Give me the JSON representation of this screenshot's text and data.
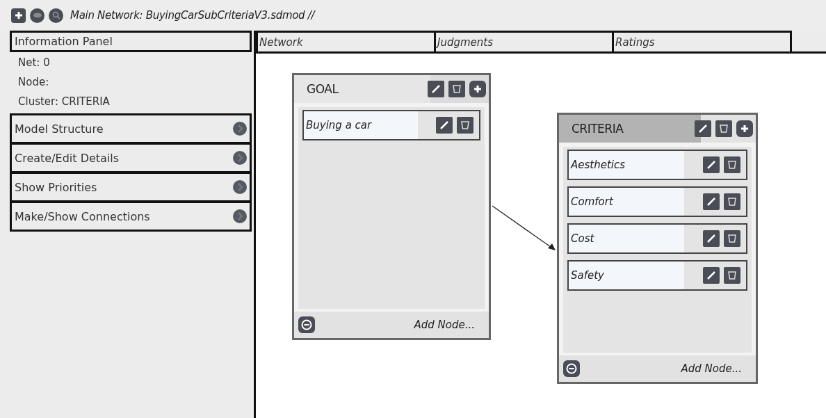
{
  "toolbar": {
    "title": "Main Network: BuyingCarSubCriteriaV3.sdmod //"
  },
  "info_panel": {
    "title": "Information Panel",
    "lines": [
      "Net: 0",
      "Node:",
      "Cluster: CRITERIA"
    ],
    "sections": [
      {
        "label": "Model Structure"
      },
      {
        "label": "Create/Edit Details"
      },
      {
        "label": "Show Priorities"
      },
      {
        "label": "Make/Show Connections"
      }
    ]
  },
  "tabs": [
    {
      "label": "Network"
    },
    {
      "label": "Judgments"
    },
    {
      "label": "Ratings"
    }
  ],
  "clusters": [
    {
      "name": "GOAL",
      "selected": false,
      "nodes": [
        "Buying a car"
      ],
      "footer": "Add Node..."
    },
    {
      "name": "CRITERIA",
      "selected": true,
      "nodes": [
        "Aesthetics",
        "Comfort",
        "Cost",
        "Safety"
      ],
      "footer": "Add Node..."
    }
  ]
}
